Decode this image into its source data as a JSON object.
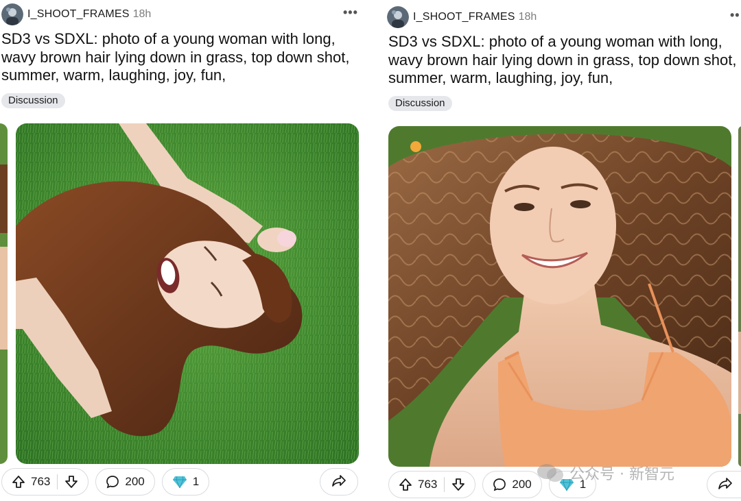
{
  "posts": [
    {
      "username": "I_SHOOT_FRAMES",
      "time": "18h",
      "title": "SD3 vs SDXL: photo of a young woman with long, wavy brown hair lying down in grass, top down shot, summer, warm, laughing, joy, fun,",
      "flair": "Discussion",
      "upvotes": "763",
      "comments": "200",
      "awards": "1"
    },
    {
      "username": "I_SHOOT_FRAMES",
      "time": "18h",
      "title": "SD3 vs SDXL: photo of a young woman with long, wavy brown hair lying down in grass, top down shot, summer, warm, laughing, joy, fun,",
      "flair": "Discussion",
      "upvotes": "763",
      "comments": "200",
      "awards": "1"
    }
  ],
  "more_icon": "more-horizontal-icon",
  "watermark": "公众号 · 新智元",
  "colors": {
    "grass": "#3f8a2f",
    "hair": "#6b3a1f",
    "top": "#f0a470",
    "award": "#4fc3d9",
    "pill_border": "#d8dadf",
    "flair_bg": "#e5e7eb"
  }
}
